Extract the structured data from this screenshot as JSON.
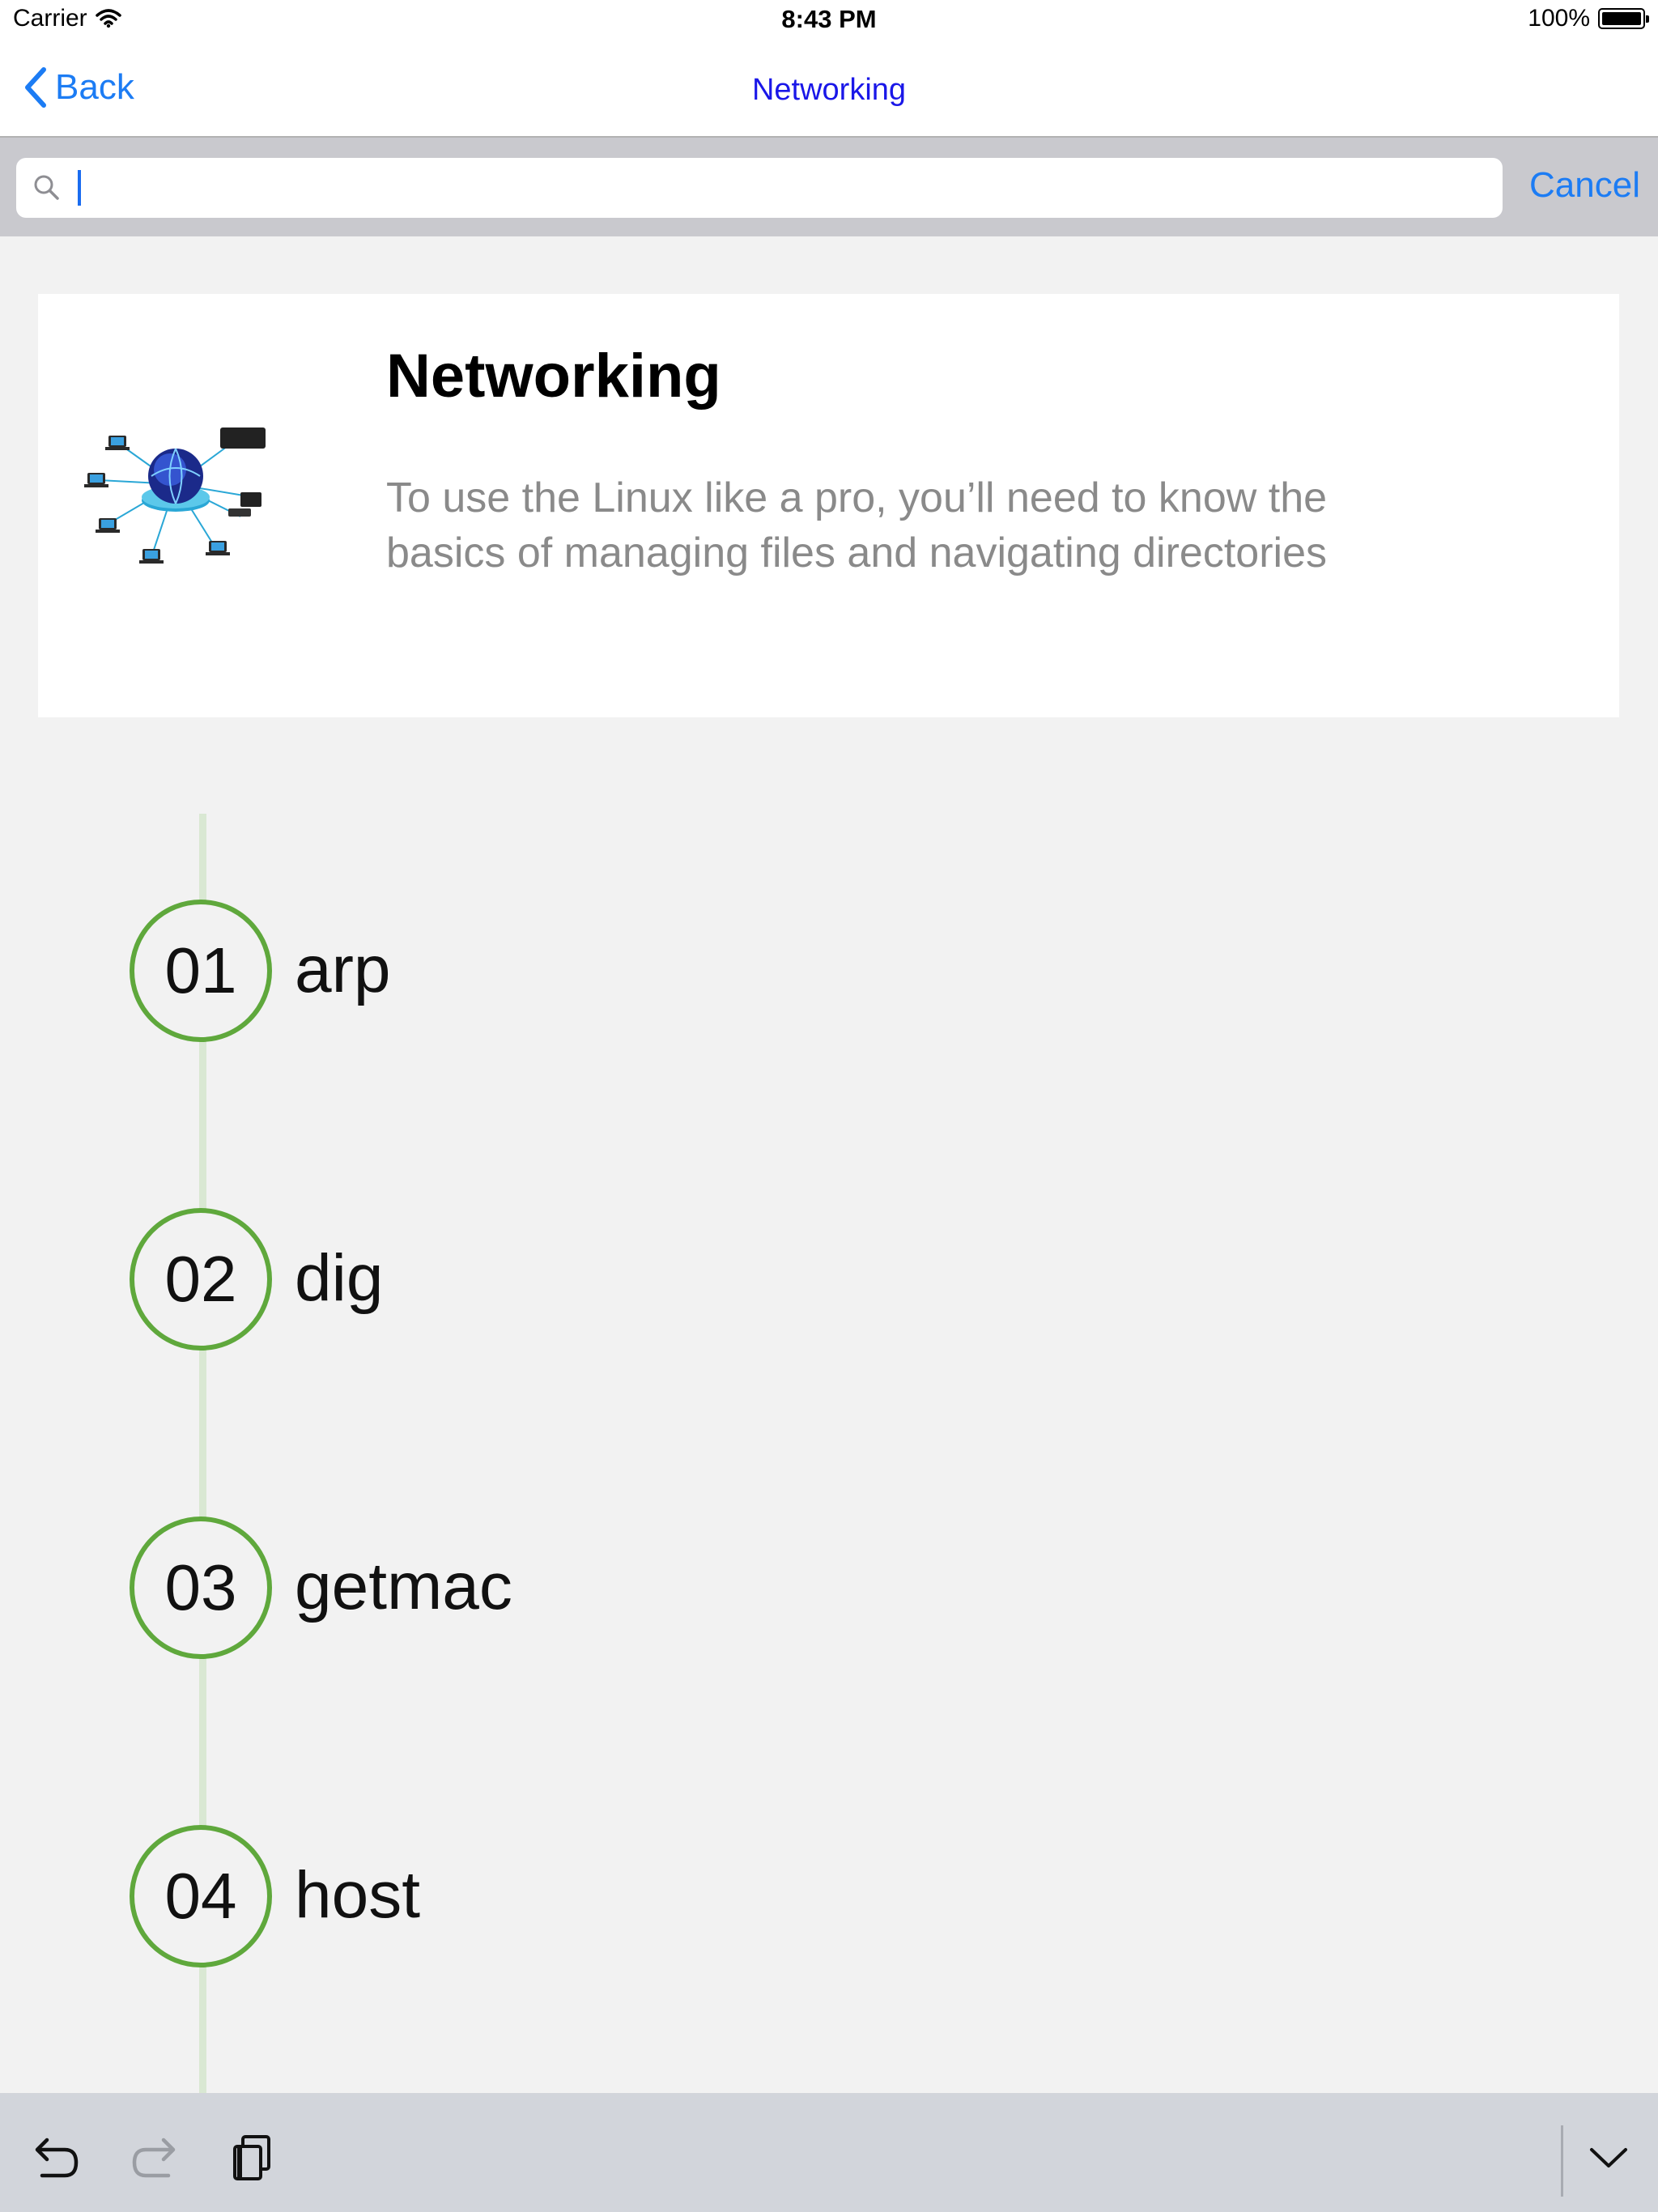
{
  "status_bar": {
    "carrier": "Carrier",
    "time": "8:43 PM",
    "battery": "100%"
  },
  "nav": {
    "back_label": "Back",
    "title": "Networking"
  },
  "search": {
    "placeholder": "",
    "value": "",
    "cancel_label": "Cancel"
  },
  "header_card": {
    "title": "Networking",
    "description": "To use the Linux  like a pro, you’ll need to know the basics of managing files and navigating directories",
    "image_icon": "network-diagram-icon"
  },
  "items": [
    {
      "number": "01",
      "label": "arp"
    },
    {
      "number": "02",
      "label": "dig"
    },
    {
      "number": "03",
      "label": "getmac"
    },
    {
      "number": "04",
      "label": "host"
    }
  ],
  "toolbar": {
    "undo_icon": "undo-icon",
    "redo_icon": "redo-icon",
    "paste_icon": "paste-icon",
    "dismiss_icon": "chevron-down-icon"
  },
  "colors": {
    "accent": "#1c7cf4",
    "nav_title": "#1a17e8",
    "timeline_ring": "#5fa83c",
    "timeline_line": "#d9e8d3",
    "background": "#f2f2f2"
  }
}
